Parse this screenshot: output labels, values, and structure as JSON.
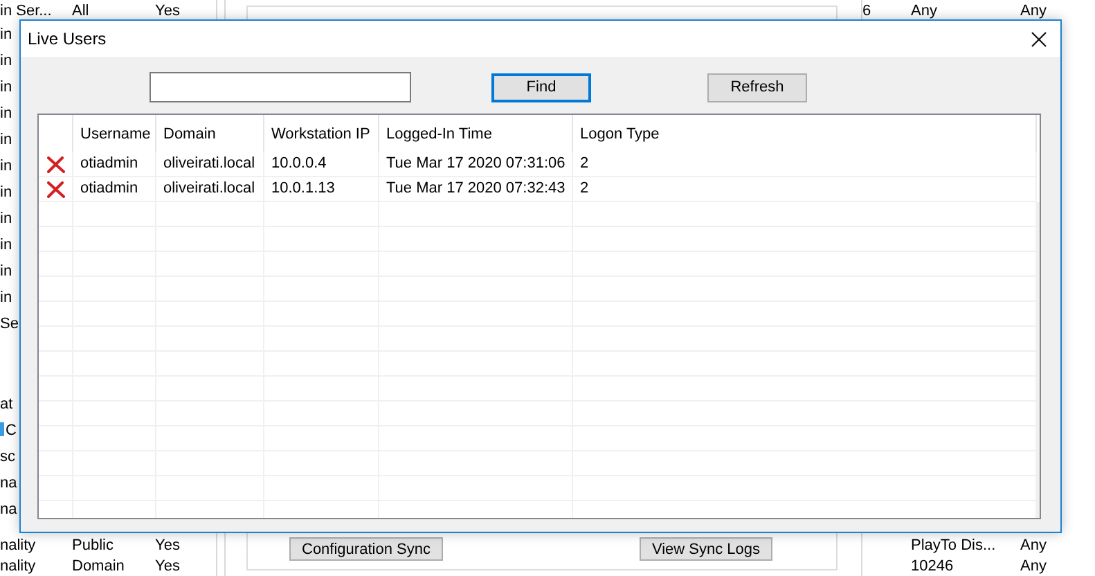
{
  "background": {
    "left_list": {
      "upper_rows": [
        {
          "column_1": "in Ser...",
          "column_2": "All",
          "column_3": "Yes"
        },
        {
          "column_1": "in"
        },
        {
          "column_1": "in"
        },
        {
          "column_1": "in"
        },
        {
          "column_1": "in"
        },
        {
          "column_1": "in"
        },
        {
          "column_1": "in"
        },
        {
          "column_1": "in"
        },
        {
          "column_1": "in"
        },
        {
          "column_1": "in"
        },
        {
          "column_1": "in"
        },
        {
          "column_1": "in"
        },
        {
          "column_1": "Se"
        }
      ],
      "middle_rows": [
        {
          "column_1": "at"
        },
        {
          "column_1": "C"
        },
        {
          "column_1": "sc"
        },
        {
          "column_1": "na"
        },
        {
          "column_1": "na"
        }
      ],
      "lower_rows": [
        {
          "column_1": "nality",
          "column_2": "Public",
          "column_3": "Yes"
        },
        {
          "column_1": "nality",
          "column_2": "Domain",
          "column_3": "Yes"
        }
      ]
    },
    "middle_panel": {
      "buttons": [
        "Configuration Sync",
        "View Sync Logs"
      ]
    },
    "right_list": {
      "upper_rows": [
        {
          "column_1": "6",
          "column_2": "Any",
          "column_3": "Any"
        }
      ],
      "lower_rows": [
        {
          "column_2": "PlayTo Dis...",
          "column_3": "Any"
        },
        {
          "column_2": "10246",
          "column_3": "Any"
        }
      ]
    }
  },
  "dialog": {
    "title": "Live Users",
    "buttons": [
      {
        "label": "Find",
        "focused": true
      },
      {
        "label": "Refresh",
        "focused": false
      }
    ],
    "table": {
      "columns": [
        "Username",
        "Domain",
        "Workstation IP",
        "Logged-In Time",
        "Logon Type"
      ],
      "rows": [
        {
          "username": "otiadmin",
          "domain": "oliveirati.local",
          "workstation_ip": "10.0.0.4",
          "logged_in_time": "Tue Mar 17 2020 07:31:06",
          "logon_type": "2"
        },
        {
          "username": "otiadmin",
          "domain": "oliveirati.local",
          "workstation_ip": "10.0.1.13",
          "logged_in_time": "Tue Mar 17 2020 07:32:43",
          "logon_type": "2"
        }
      ]
    }
  }
}
